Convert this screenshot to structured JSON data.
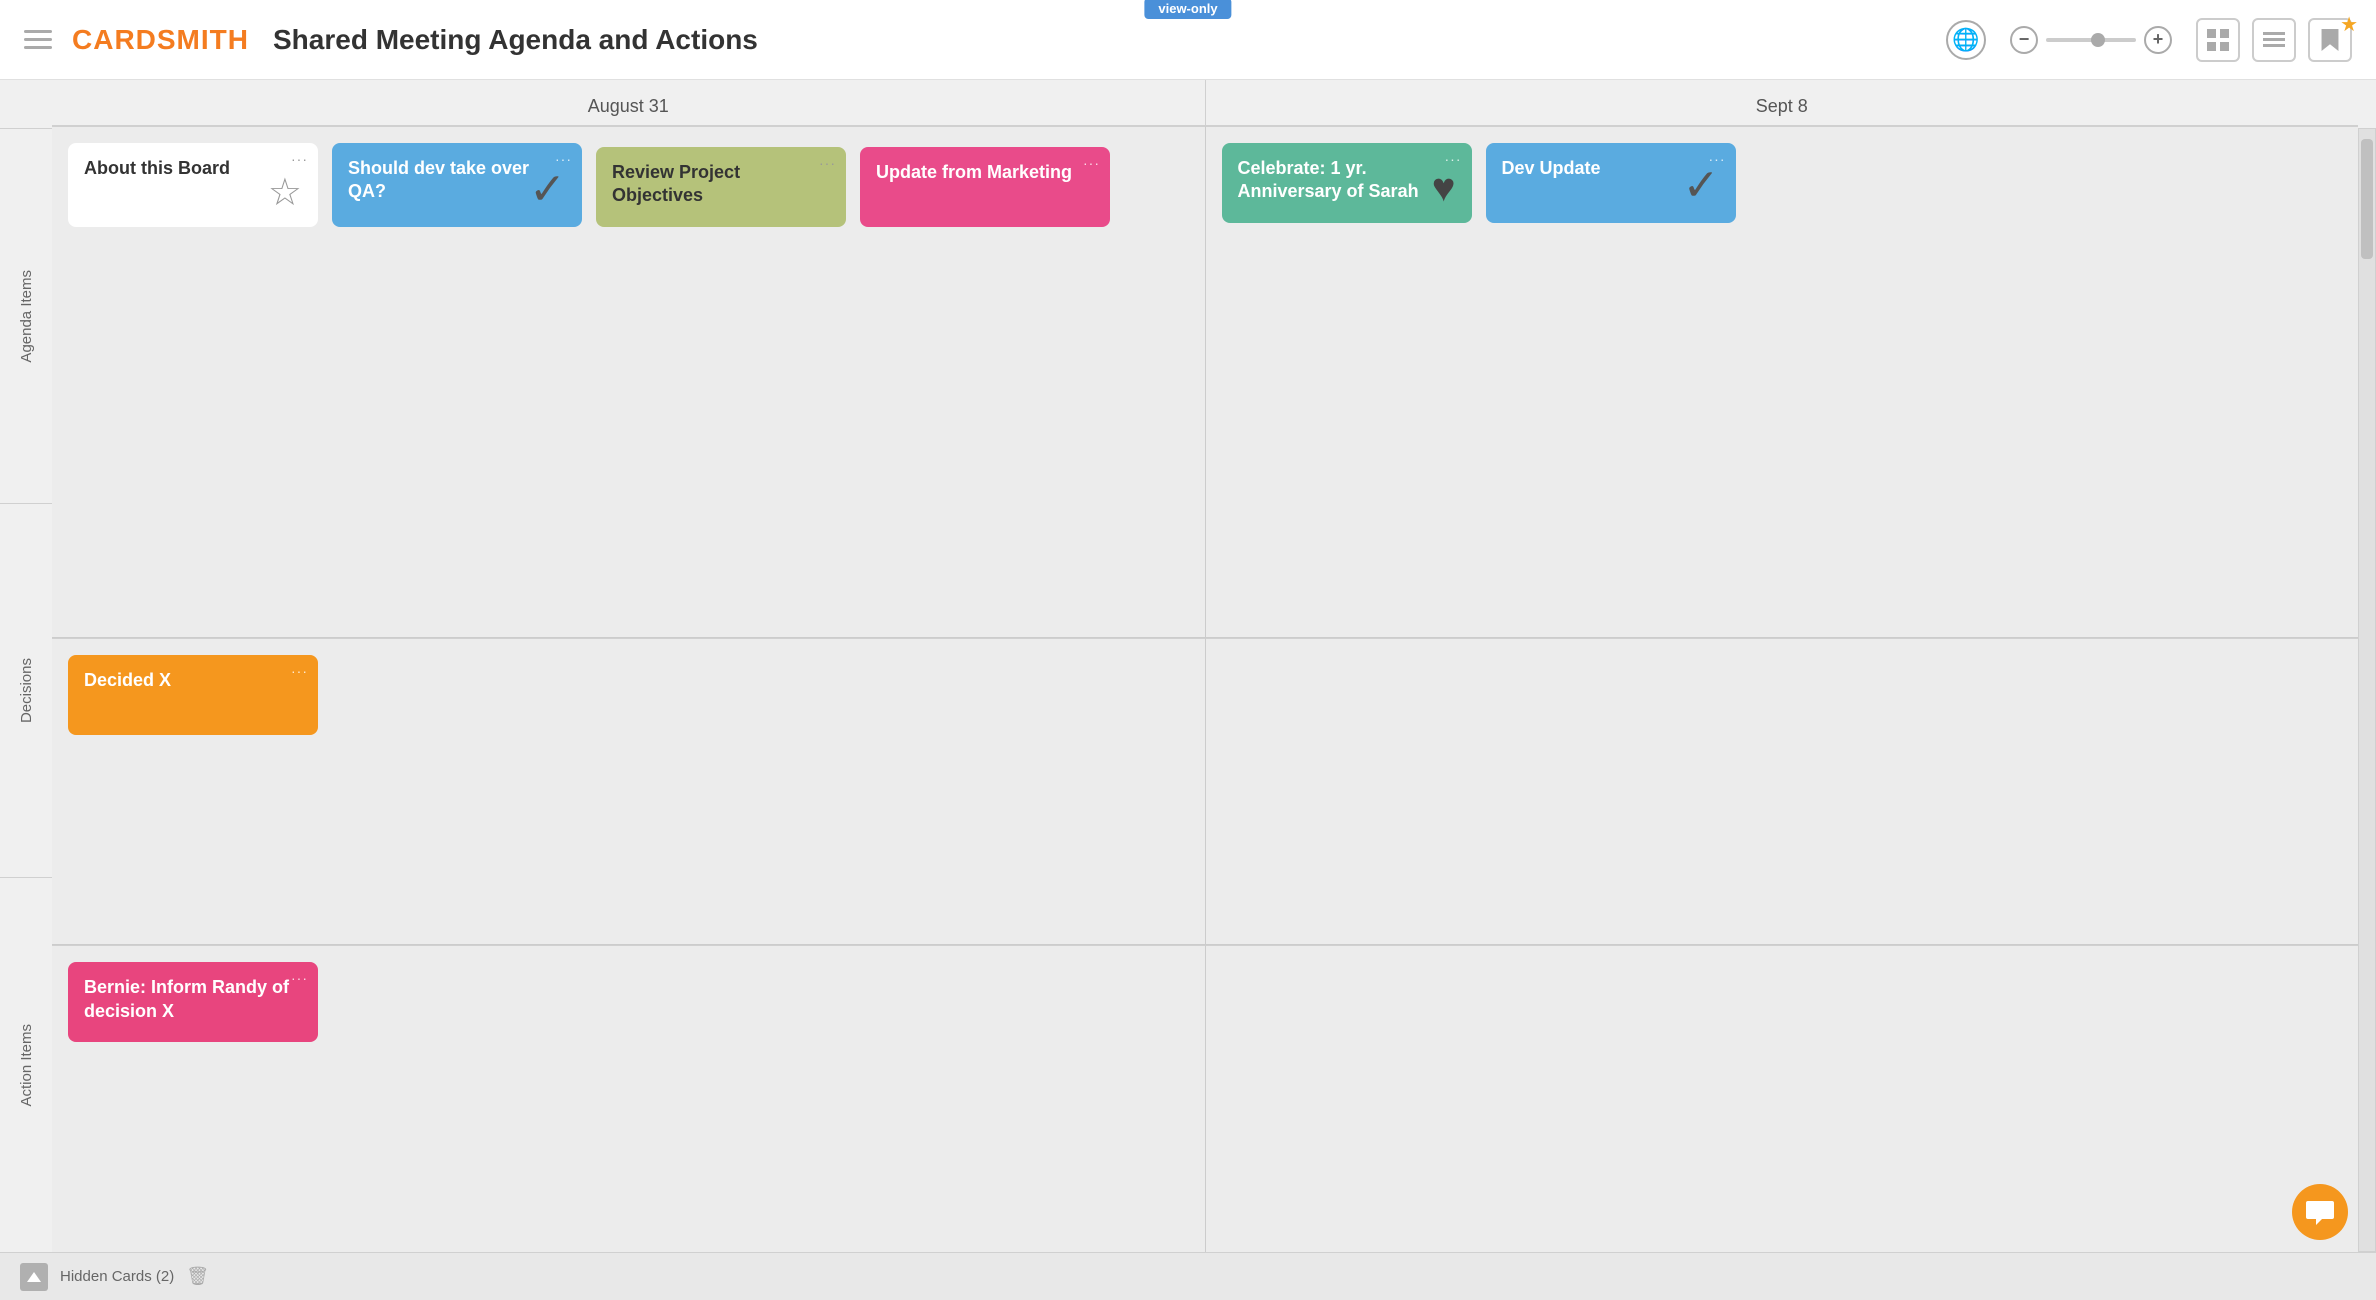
{
  "header": {
    "logo": "CARDSMITH",
    "title": "Shared Meeting Agenda and Actions",
    "view_only_badge": "view-only",
    "zoom_minus": "−",
    "zoom_plus": "+",
    "grid_icon": "⊞",
    "list_icon": "≡",
    "star_icon": "★"
  },
  "columns": [
    {
      "label": "August 31"
    },
    {
      "label": "Sept 8"
    }
  ],
  "rows": [
    {
      "label": "Agenda Items"
    },
    {
      "label": "Decisions"
    },
    {
      "label": "Action Items"
    }
  ],
  "cards": {
    "agenda_aug31": [
      {
        "id": "about-board",
        "title": "About this Board",
        "color": "white",
        "icon": "star",
        "icon_type": "star"
      },
      {
        "id": "should-dev",
        "title": "Should dev take over QA?",
        "color": "blue",
        "icon": "✓",
        "icon_type": "check"
      },
      {
        "id": "review-project",
        "title": "Review Project Objectives",
        "color": "olive",
        "icon": "",
        "icon_type": "none"
      },
      {
        "id": "update-marketing",
        "title": "Update from Marketing",
        "color": "pink",
        "icon": "",
        "icon_type": "none"
      }
    ],
    "agenda_sept8": [
      {
        "id": "celebrate-sarah",
        "title": "Celebrate: 1 yr. Anniversary of Sarah",
        "color": "teal",
        "icon": "♥",
        "icon_type": "heart"
      },
      {
        "id": "dev-update",
        "title": "Dev Update",
        "color": "blue",
        "icon": "✓",
        "icon_type": "check"
      }
    ],
    "decisions_aug31": [
      {
        "id": "decided-x",
        "title": "Decided X",
        "color": "orange",
        "icon": "",
        "icon_type": "none"
      }
    ],
    "decisions_sept8": [],
    "actions_aug31": [
      {
        "id": "bernie-inform",
        "title": "Bernie: Inform Randy of decision X",
        "color": "hotpink",
        "icon": "",
        "icon_type": "none"
      }
    ],
    "actions_sept8": []
  },
  "footer": {
    "hidden_cards_label": "Hidden Cards (2)",
    "trash_icon": "🗑"
  },
  "chat_icon": "💬"
}
